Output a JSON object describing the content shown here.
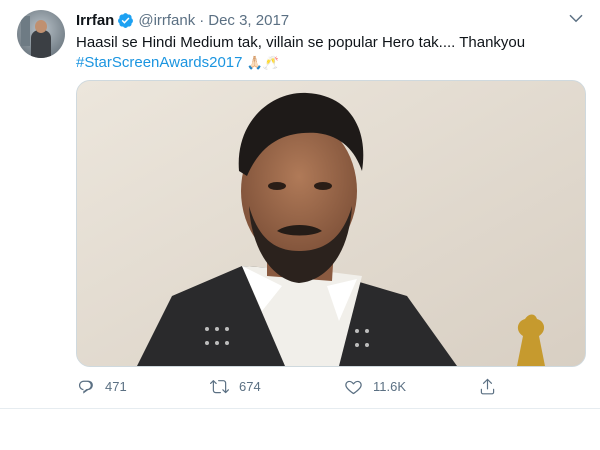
{
  "tweet": {
    "author_name": "Irrfan",
    "handle": "@irrfank",
    "separator": "·",
    "date": "Dec 3, 2017",
    "text": "Haasil se Hindi Medium tak, villain se popular Hero tak.... Thankyou",
    "hashtag": "#StarScreenAwards2017",
    "emojis": "🙏🏻🥂",
    "verified": true
  },
  "actions": {
    "reply_count": "471",
    "retweet_count": "674",
    "like_count": "11.6K"
  },
  "icons": {
    "verified": "verified-badge-icon",
    "more": "chevron-down-icon",
    "reply": "reply-icon",
    "retweet": "retweet-icon",
    "like": "heart-icon",
    "share": "share-icon"
  },
  "colors": {
    "link": "#1b95e0",
    "verified": "#1da1f2",
    "secondary_text": "#5b7083"
  }
}
